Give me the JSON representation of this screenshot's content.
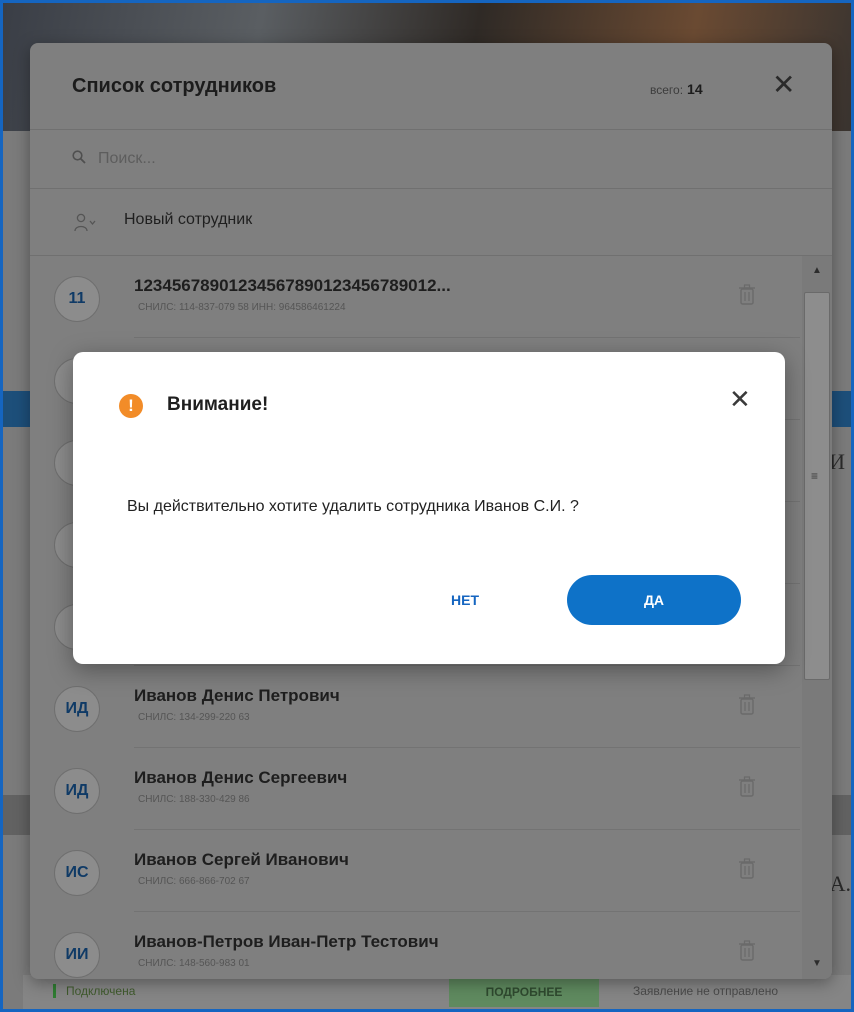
{
  "panel": {
    "title": "Список сотрудников",
    "total_label": "всего:",
    "total_value": "14",
    "search_placeholder": "Поиск...",
    "new_employee_label": "Новый сотрудник",
    "employees": [
      {
        "initials": "11",
        "name": "123456789012345678901234567890​12...",
        "details": "СНИЛС: 114-837-079 58 ИНН: 964586461224"
      },
      {
        "initials": "ИД",
        "name": "Иванов Денис Петрович",
        "details": "СНИЛС: 134-299-220 63"
      },
      {
        "initials": "ИД",
        "name": "Иванов Денис Сергеевич",
        "details": "СНИЛС: 188-330-429 86"
      },
      {
        "initials": "ИС",
        "name": "Иванов Сергей Иванович",
        "details": "СНИЛС: 666-866-702 67"
      },
      {
        "initials": "ИИ",
        "name": "Иванов-Петров Иван-Петр Тестович",
        "details": "СНИЛС: 148-560-983 01"
      }
    ]
  },
  "background": {
    "right_text_1": "й И",
    "right_text_2": "А.",
    "footer_status": "Подключена",
    "footer_more": "ПОДРОБНЕЕ",
    "footer_note": "Заявление не отправлено"
  },
  "dialog": {
    "title": "Внимание!",
    "message": "Вы действительно хотите удалить сотрудника Иванов С.И. ?",
    "no_label": "НЕТ",
    "yes_label": "ДА"
  },
  "colors": {
    "accent": "#0e72c8",
    "warning": "#f28c28",
    "frame_border": "#1565c0"
  }
}
